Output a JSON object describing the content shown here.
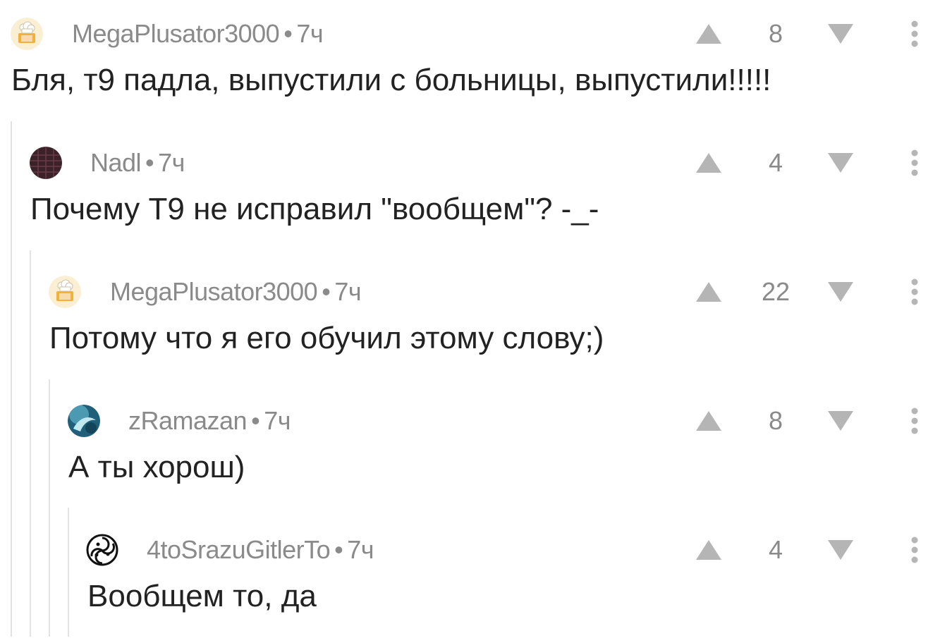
{
  "comments": [
    {
      "author": "MegaPlusator3000",
      "time": "7ч",
      "rating": "8",
      "text": "Бля, т9 падла, выпустили с больницы, выпустили!!!!!",
      "avatar_icon": "chef-avatar-icon"
    },
    {
      "author": "Nadl",
      "time": "7ч",
      "rating": "4",
      "text": "Почему Т9 не исправил \"вообщем\"? -_-",
      "avatar_icon": "dark-pattern-avatar-icon"
    },
    {
      "author": "MegaPlusator3000",
      "time": "7ч",
      "rating": "22",
      "text": "Потому что я его обучил этому слову;)",
      "avatar_icon": "chef-avatar-icon"
    },
    {
      "author": "zRamazan",
      "time": "7ч",
      "rating": "8",
      "text": "А ты хорош)",
      "avatar_icon": "dolphin-avatar-icon"
    },
    {
      "author": "4toSrazuGitlerTo",
      "time": "7ч",
      "rating": "4",
      "text": "Вообщем то, да",
      "avatar_icon": "triskelion-avatar-icon"
    }
  ],
  "separator": "•",
  "colors": {
    "meta": "#8a8a8a",
    "text": "#222222",
    "guide": "#e3e3e3",
    "icon": "#b5b5b5"
  }
}
